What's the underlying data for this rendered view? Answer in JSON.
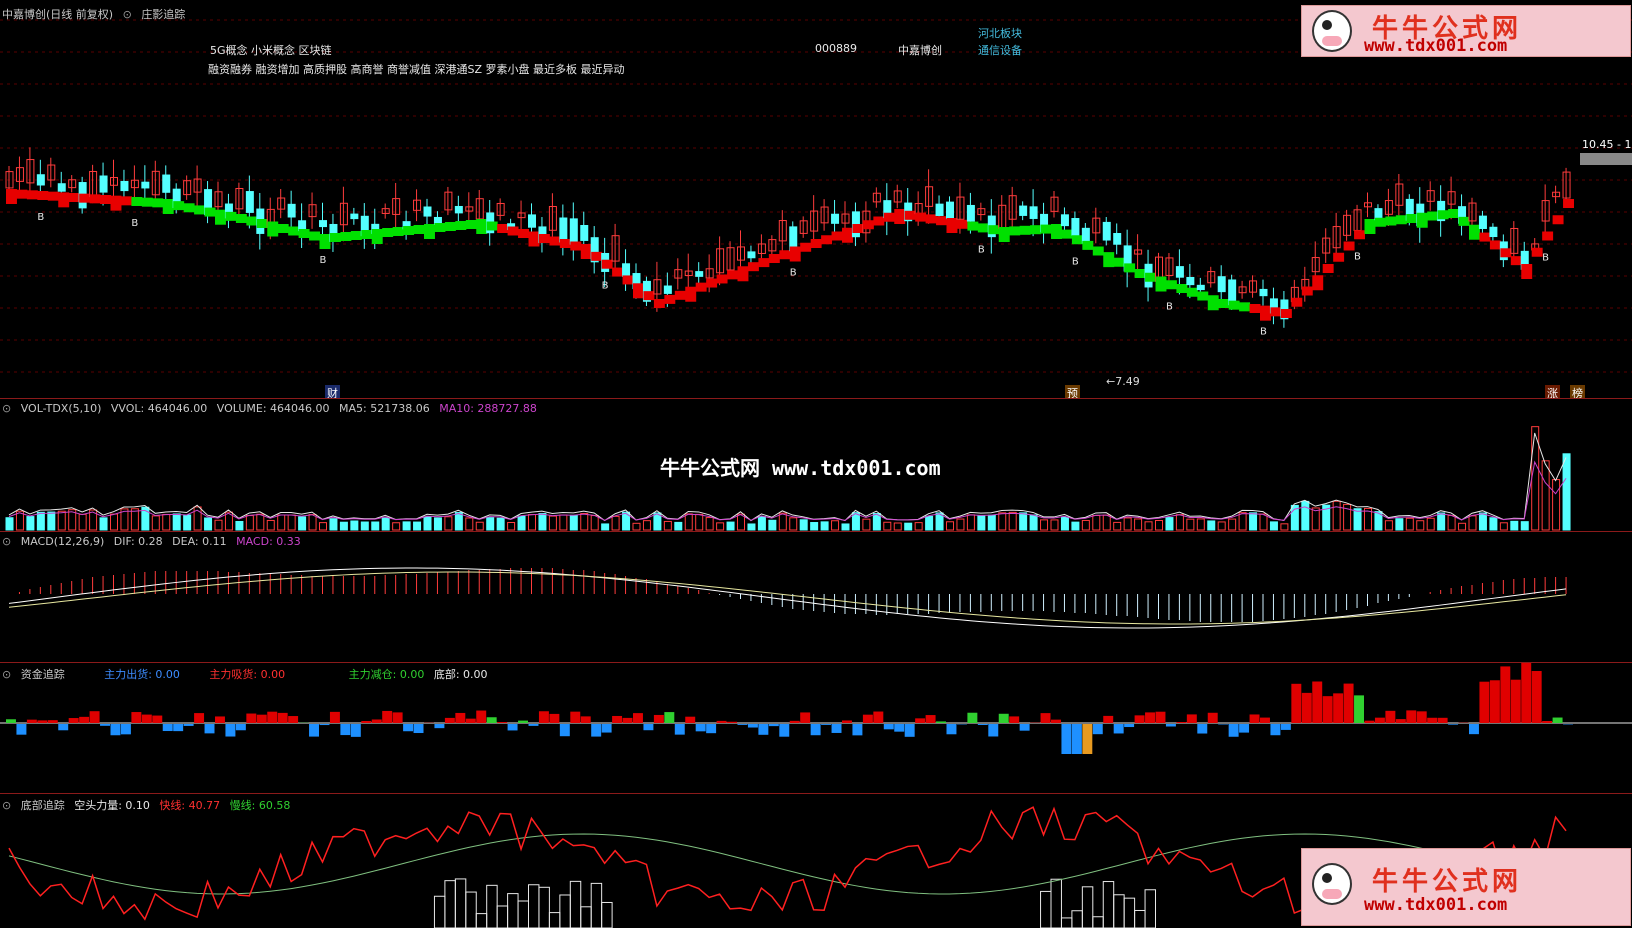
{
  "main": {
    "title": "中嘉博创(日线 前复权)",
    "indicator": "庄影追踪",
    "concepts_line1": "5G概念 小米概念 区块链",
    "concepts_line2": "融资融券 融资增加 高质押股 高商誉 商誉减值 深港通SZ 罗素小盘 最近多板 最近异动",
    "stock_code": "000889",
    "stock_name": "中嘉博创",
    "sector": "河北板块",
    "industry": "通信设备",
    "price_label": "10.45 - 1",
    "low_label": "7.49",
    "tag_cai": "财",
    "tag_yu": "预",
    "tag_zhang": "涨",
    "tag_bang": "榜",
    "b_marker": "B"
  },
  "volume_panel": {
    "name": "VOL-TDX(5,10)",
    "vvol": "VVOL: 464046.00",
    "volume": "VOLUME: 464046.00",
    "ma5": "MA5: 521738.06",
    "ma10": "MA10: 288727.88"
  },
  "macd_panel": {
    "name": "MACD(12,26,9)",
    "dif": "DIF: 0.28",
    "dea": "DEA: 0.11",
    "macd": "MACD: 0.33"
  },
  "fund_panel": {
    "name": "资金追踪",
    "out": "主力出货: 0.00",
    "in": "主力吸货: 0.00",
    "reduce": "主力减仓: 0.00",
    "bottom": "底部: 0.00"
  },
  "bottom_panel": {
    "name": "底部追踪",
    "power": "空头力量: 0.10",
    "fast": "快线: 40.77",
    "slow": "慢线: 60.58"
  },
  "watermark": {
    "center": "牛牛公式网 www.tdx001.com",
    "logo_cn": "牛牛公式网",
    "logo_url": "www.tdx001.com"
  },
  "colors": {
    "up": "#ff3c3c",
    "down": "#54ffff",
    "trend_up": "#e80000",
    "trend_down": "#00e000",
    "fund_in": "#e00000",
    "fund_out": "#1e90ff",
    "macd_line": "#ffffff",
    "ma10": "#cc44cc"
  }
}
